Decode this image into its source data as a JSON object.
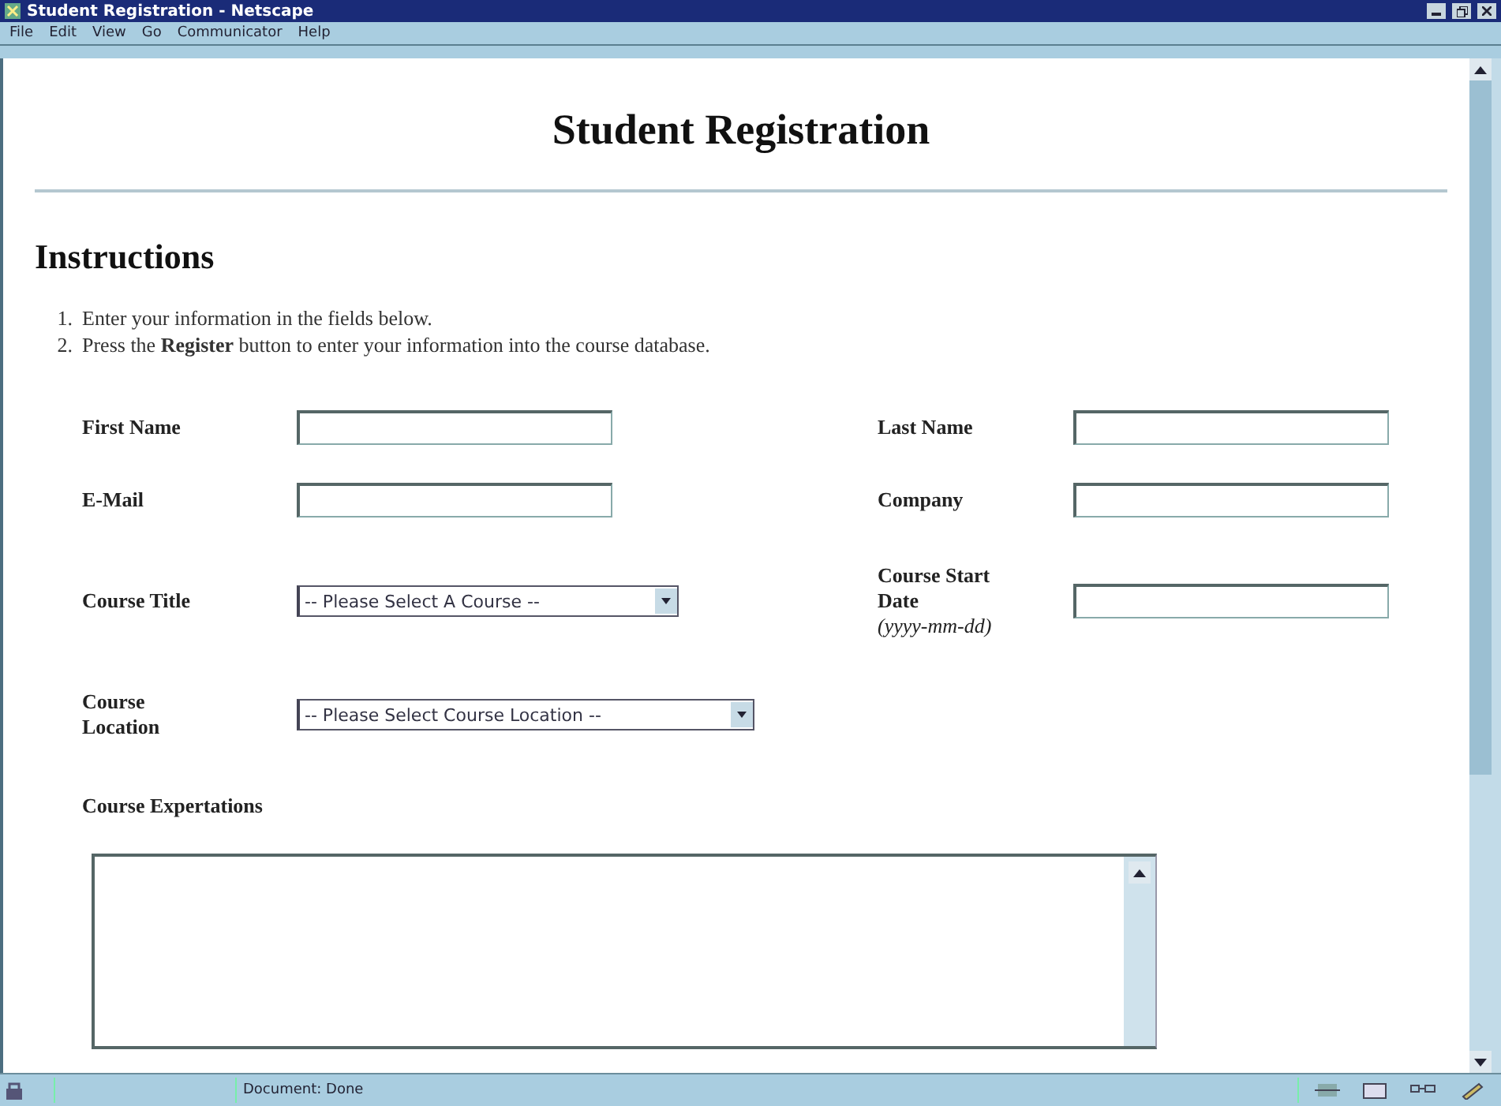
{
  "window": {
    "title": "Student Registration - Netscape"
  },
  "menu": [
    "File",
    "Edit",
    "View",
    "Go",
    "Communicator",
    "Help"
  ],
  "page": {
    "heading": "Student Registration",
    "section": "Instructions",
    "instructions": [
      {
        "number": "1.",
        "text": "Enter your information in the fields below."
      },
      {
        "number": "2.",
        "text": "Press the **Register** button to enter your information into the course database."
      }
    ],
    "columns": [
      {
        "fields": [
          {
            "kind": "text",
            "label": "First Name"
          },
          {
            "kind": "text",
            "label": "E-Mail"
          },
          {
            "kind": "select",
            "label": "Course Title",
            "value": "-- Please Select A Course --"
          },
          {
            "kind": "select",
            "label": "Course Location",
            "value": "-- Please Select Course Location --"
          }
        ]
      },
      {
        "fields": [
          {
            "kind": "text",
            "label": "Last Name"
          },
          {
            "kind": "text",
            "label": "Company"
          },
          {
            "kind": "text",
            "label": "Course Start Date",
            "hint": "(yyyy-mm-dd)"
          }
        ]
      }
    ],
    "expectations": {
      "label": "Course Expertations"
    }
  },
  "status_bar": {
    "text": "Document: Done"
  }
}
